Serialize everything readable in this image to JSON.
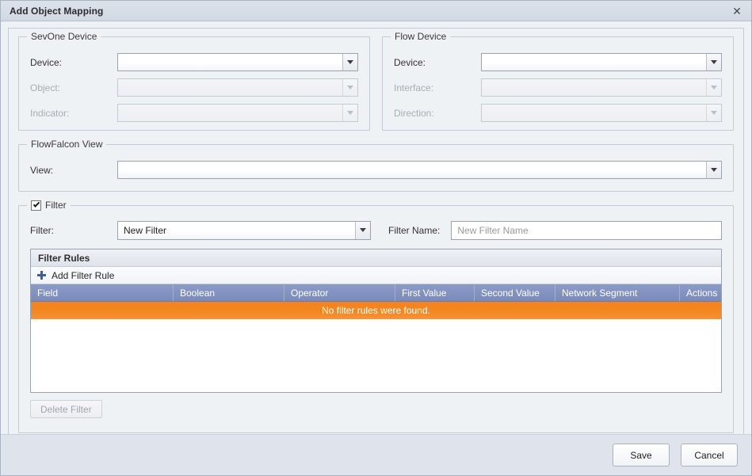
{
  "window": {
    "title": "Add Object Mapping",
    "close_icon": "close-icon",
    "close_label": "✕"
  },
  "sevone_device": {
    "legend": "SevOne Device",
    "fields": [
      {
        "label": "Device:",
        "value": "",
        "disabled": false
      },
      {
        "label": "Object:",
        "value": "",
        "disabled": true
      },
      {
        "label": "Indicator:",
        "value": "",
        "disabled": true
      }
    ]
  },
  "flow_device": {
    "legend": "Flow Device",
    "fields": [
      {
        "label": "Device:",
        "value": "",
        "disabled": false
      },
      {
        "label": "Interface:",
        "value": "",
        "disabled": true
      },
      {
        "label": "Direction:",
        "value": "",
        "disabled": true
      }
    ]
  },
  "flowfalcon_view": {
    "legend": "FlowFalcon View",
    "view_label": "View:",
    "view_value": ""
  },
  "filter": {
    "legend": "Filter",
    "checkbox_checked": true,
    "filter_label": "Filter:",
    "filter_value": "New Filter",
    "filter_name_label": "Filter Name:",
    "filter_name_value": "",
    "filter_name_placeholder": "New Filter Name",
    "delete_button": "Delete Filter",
    "delete_button_disabled": true,
    "grid": {
      "title": "Filter Rules",
      "add_rule_label": "Add Filter Rule",
      "add_rule_icon": "plus-icon",
      "columns": [
        "Field",
        "Boolean",
        "Operator",
        "First Value",
        "Second Value",
        "Network Segment",
        "Actions"
      ],
      "rows": [],
      "empty_message": "No filter rules were found."
    }
  },
  "footer": {
    "save_label": "Save",
    "cancel_label": "Cancel"
  },
  "colors": {
    "accent_orange": "#f58220",
    "header_blue": "#7a8bbb",
    "titlebar": "#d6dce6",
    "panel_bg": "#eef2f5"
  }
}
